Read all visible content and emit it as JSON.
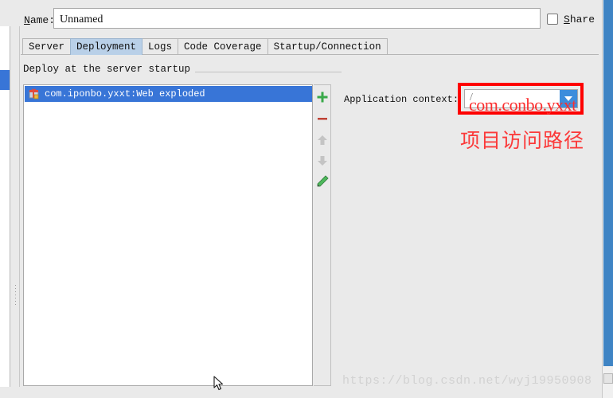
{
  "window": {
    "name_label": "Name:",
    "name_label_mnemonic": "N",
    "name_value": "Unnamed",
    "name_placeholder": "Unnamed",
    "share_label": "Share",
    "share_label_mnemonic": "S",
    "share_checked": false
  },
  "tabs": [
    {
      "label": "Server",
      "selected": false
    },
    {
      "label": "Deployment",
      "selected": true
    },
    {
      "label": "Logs",
      "selected": false
    },
    {
      "label": "Code Coverage",
      "selected": false
    },
    {
      "label": "Startup/Connection",
      "selected": false
    }
  ],
  "deployment": {
    "group_title": "Deploy at the server startup",
    "list": [
      {
        "label": "com.iponbo.yxxt:Web exploded",
        "icon": "artifact-icon",
        "selected": true
      }
    ],
    "toolbar": [
      {
        "name": "add-button",
        "icon": "plus-icon",
        "enabled": true
      },
      {
        "name": "remove-button",
        "icon": "minus-icon",
        "enabled": true
      },
      {
        "name": "move-up-button",
        "icon": "arrow-up-icon",
        "enabled": false
      },
      {
        "name": "move-down-button",
        "icon": "arrow-down-icon",
        "enabled": false
      },
      {
        "name": "edit-button",
        "icon": "pencil-icon",
        "enabled": true
      }
    ],
    "application_context_label": "Application context:",
    "application_context_value": "/",
    "application_context_placeholder": "/"
  },
  "annotations": {
    "highlight_color": "#fe0000",
    "text_color": "#fb2f2f",
    "overlay_text": "com.conbo.yxxt",
    "chinese_note": "项目访问路径"
  },
  "watermark": {
    "text": "https://blog.csdn.net/wyj19950908"
  },
  "colors": {
    "accent_selection": "#3875d7",
    "tab_selected_bg": "#b9d0e8",
    "combo_arrow_bg": "#3c8ddc",
    "panel_bg": "#eaeaea",
    "field_bg": "#ffffff"
  }
}
